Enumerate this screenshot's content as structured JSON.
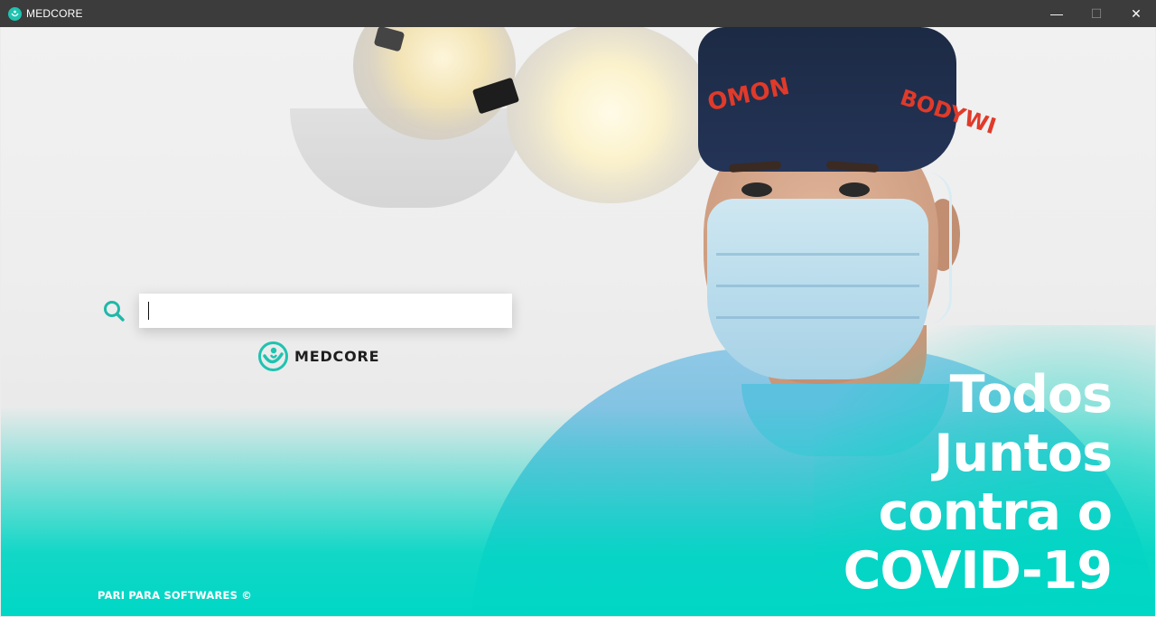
{
  "window": {
    "title": "MEDCORE",
    "controls": {
      "minimize": "—",
      "maximize": "☐",
      "close": "✕"
    }
  },
  "search": {
    "value": "",
    "placeholder": "",
    "icon": "search-icon"
  },
  "logo": {
    "text": "MEDCORE",
    "icon": "medcore-logo-icon"
  },
  "slogan": {
    "lines": [
      "Todos",
      "Juntos",
      "contra o",
      "COVID-19"
    ]
  },
  "doctor_cap": {
    "left_text": "OMON",
    "right_text": "BODYWI"
  },
  "footer": {
    "copyright": "PARI PARA SOFTWARES ©"
  },
  "colors": {
    "accent": "#00d7c5",
    "titlebar": "#3c3c3c",
    "logo_teal": "#1fc3b0"
  }
}
